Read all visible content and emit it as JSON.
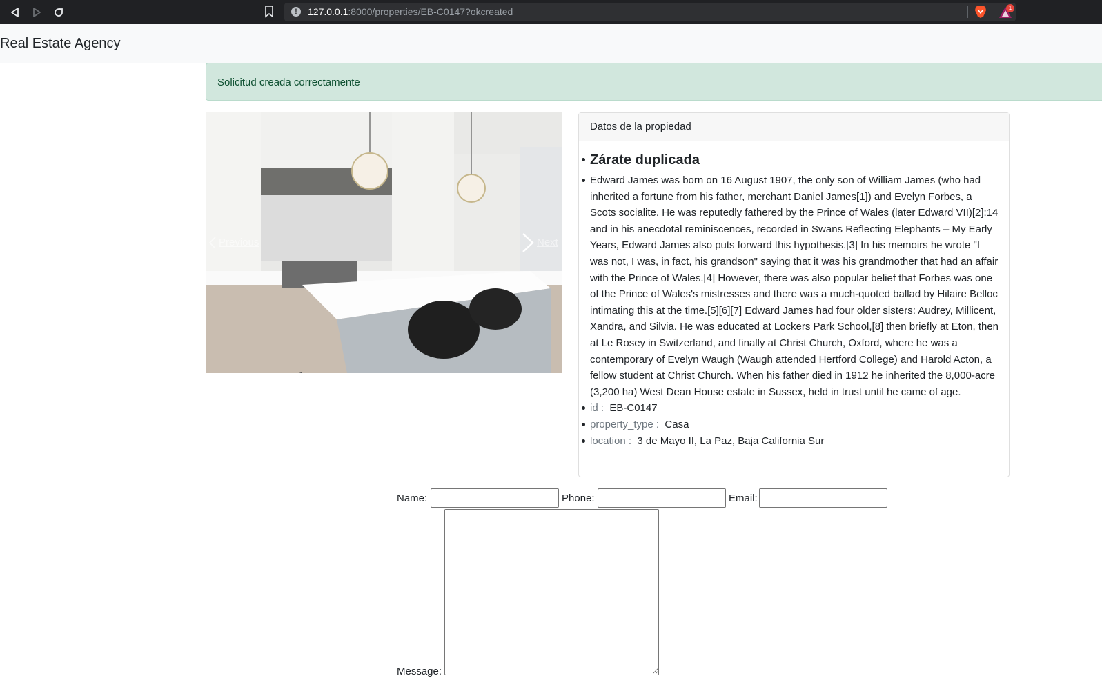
{
  "browser": {
    "url_host": "127.0.0.1",
    "url_rest": ":8000/properties/EB-C0147?okcreated",
    "icons": [
      "back-icon",
      "forward-icon",
      "reload-icon",
      "bookmark-icon",
      "site-info-icon",
      "brave-shields-icon",
      "brave-rewards-icon"
    ],
    "rewards_badge": "1"
  },
  "navbar": {
    "brand": "Real Estate Agency"
  },
  "alert": {
    "text": "Solicitud creada correctamente"
  },
  "carousel": {
    "prev_label": "Previous",
    "next_label": "Next"
  },
  "card": {
    "header": "Datos de la propiedad",
    "title": "Zárate duplicada",
    "description": "Edward James was born on 16 August 1907, the only son of William James (who had inherited a fortune from his father, merchant Daniel James[1]) and Evelyn Forbes, a Scots socialite. He was reputedly fathered by the Prince of Wales (later Edward VII)[2]:14 and in his anecdotal reminiscences, recorded in Swans Reflecting Elephants – My Early Years, Edward James also puts forward this hypothesis.[3] In his memoirs he wrote \"I was not, I was, in fact, his grandson\" saying that it was his grandmother that had an affair with the Prince of Wales.[4] However, there was also popular belief that Forbes was one of the Prince of Wales's mistresses and there was a much-quoted ballad by Hilaire Belloc intimating this at the time.[5][6][7] Edward James had four older sisters: Audrey, Millicent, Xandra, and Silvia. He was educated at Lockers Park School,[8] then briefly at Eton, then at Le Rosey in Switzerland, and finally at Christ Church, Oxford, where he was a contemporary of Evelyn Waugh (Waugh attended Hertford College) and Harold Acton, a fellow student at Christ Church. When his father died in 1912 he inherited the 8,000-acre (3,200 ha) West Dean House estate in Sussex, held in trust until he came of age.",
    "fields": [
      {
        "key": "id :",
        "value": "EB-C0147"
      },
      {
        "key": "property_type :",
        "value": "Casa"
      },
      {
        "key": "location :",
        "value": "3 de Mayo II, La Paz, Baja California Sur"
      }
    ]
  },
  "form": {
    "name_label": "Name:",
    "phone_label": "Phone:",
    "email_label": "Email:",
    "message_label": "Message:",
    "name_value": "",
    "phone_value": "",
    "email_value": "",
    "message_value": ""
  }
}
